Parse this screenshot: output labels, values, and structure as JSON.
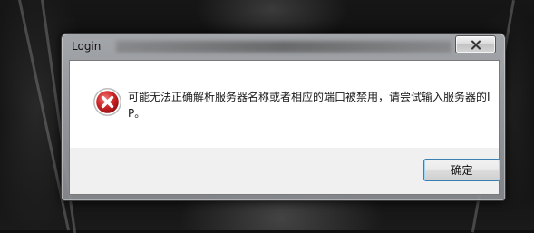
{
  "window": {
    "title": "Login"
  },
  "dialog": {
    "message": "可能无法正确解析服务器名称或者相应的端口被禁用，请尝试输入服务器的IP。",
    "icon": "error-icon",
    "ok_label": "确定"
  },
  "colors": {
    "error_red": "#c9171e",
    "button_focus_border": "#3c7fb1"
  }
}
